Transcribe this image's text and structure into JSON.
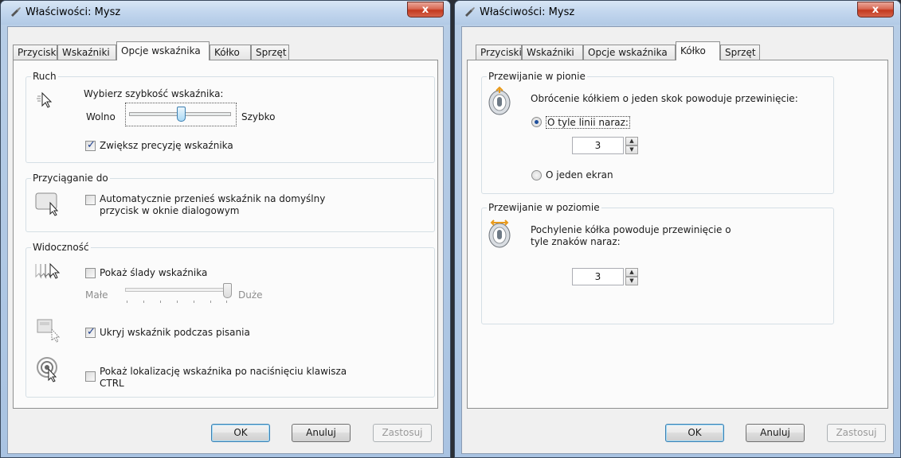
{
  "left_window": {
    "title": "Właściwości: Mysz",
    "close_label": "x",
    "tabs": [
      {
        "label": "Przyciski"
      },
      {
        "label": "Wskaźniki"
      },
      {
        "label": "Opcje wskaźnika"
      },
      {
        "label": "Kółko"
      },
      {
        "label": "Sprzęt"
      }
    ],
    "active_tab": "Opcje wskaźnika",
    "motion": {
      "group_label": "Ruch",
      "speed_label": "Wybierz szybkość wskaźnika:",
      "slow_label": "Wolno",
      "fast_label": "Szybko",
      "speed_level": 0.5,
      "precision_label": "Zwiększ precyzję wskaźnika",
      "precision_checked": true
    },
    "snap": {
      "group_label": "Przyciąganie do",
      "line1": "Automatycznie przenieś wskaźnik na domyślny",
      "line2": "przycisk w oknie dialogowym",
      "checked": false
    },
    "visibility": {
      "group_label": "Widoczność",
      "trails_label": "Pokaż ślady wskaźnika",
      "trails_checked": false,
      "small_label": "Małe",
      "large_label": "Duże",
      "trails_level": 1.0,
      "hide_label": "Ukryj wskaźnik podczas pisania",
      "hide_checked": true,
      "ctrl_line1": "Pokaż lokalizację wskaźnika po naciśnięciu klawisza",
      "ctrl_line2": "CTRL",
      "ctrl_checked": false
    },
    "buttons": {
      "ok": "OK",
      "cancel": "Anuluj",
      "apply": "Zastosuj"
    }
  },
  "right_window": {
    "title": "Właściwości: Mysz",
    "close_label": "x",
    "tabs": [
      {
        "label": "Przyciski"
      },
      {
        "label": "Wskaźniki"
      },
      {
        "label": "Opcje wskaźnika"
      },
      {
        "label": "Kółko"
      },
      {
        "label": "Sprzęt"
      }
    ],
    "active_tab": "Kółko",
    "vertical": {
      "group_label": "Przewijanie w pionie",
      "description": "Obrócenie kółkiem o jeden skok powoduje przewinięcie:",
      "lines_label": "O tyle linii naraz:",
      "lines_selected": true,
      "lines_value": "3",
      "screen_label": "O jeden ekran",
      "screen_selected": false
    },
    "horizontal": {
      "group_label": "Przewijanie w poziomie",
      "line1": "Pochylenie kółka powoduje przewinięcie o",
      "line2": "tyle znaków naraz:",
      "value": "3"
    },
    "buttons": {
      "ok": "OK",
      "cancel": "Anuluj",
      "apply": "Zastosuj"
    }
  },
  "colors": {
    "accent": "#3c7fb1",
    "close_button": "#c3391f",
    "radio_dot": "#1e4f9c"
  },
  "icons": [
    "mouse-pointer-icon",
    "pointer-speed-icon",
    "snap-to-icon",
    "pointer-trails-icon",
    "hide-pointer-icon",
    "pointer-location-icon",
    "wheel-vertical-icon",
    "wheel-horizontal-icon"
  ]
}
